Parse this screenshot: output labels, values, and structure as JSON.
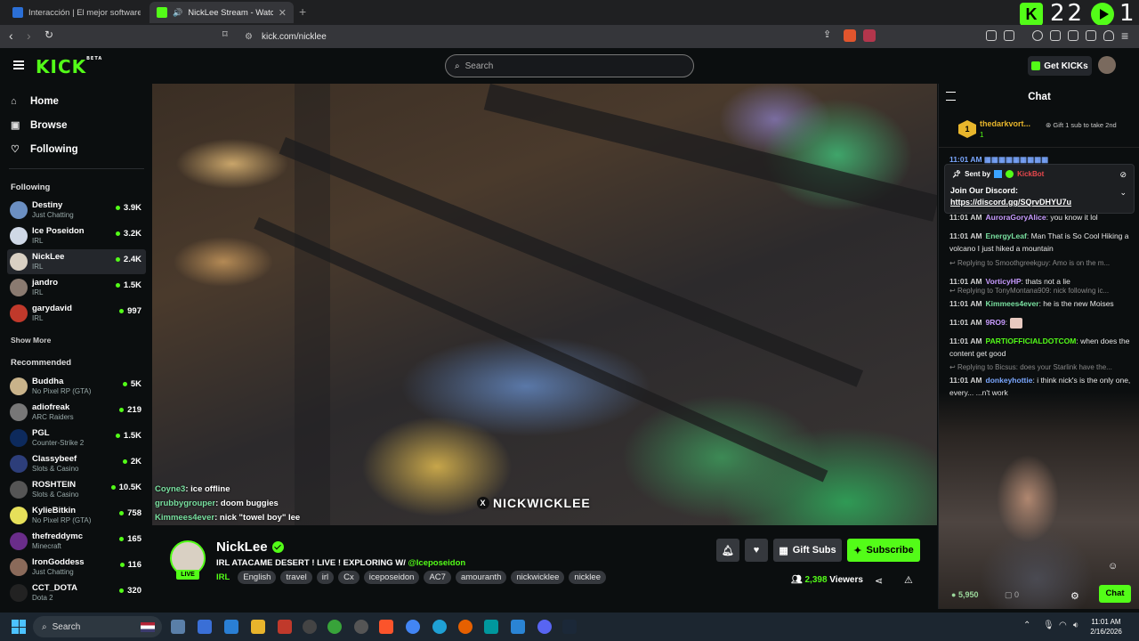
{
  "browser": {
    "tabs": [
      {
        "title": "Interacción | El mejor software para p",
        "active": false
      },
      {
        "title": "NickLee Stream - Watch Live",
        "active": true
      }
    ],
    "url": "kick.com/nicklee"
  },
  "overlay": {
    "count_left": "22",
    "count_right": "1"
  },
  "header": {
    "search_placeholder": "Search",
    "get_kicks_label": "Get KICKs",
    "logo_text": "KICK",
    "logo_beta": "BETA"
  },
  "sidebar": {
    "nav": [
      {
        "label": "Home",
        "icon": "home-icon"
      },
      {
        "label": "Browse",
        "icon": "browse-icon"
      },
      {
        "label": "Following",
        "icon": "heart-icon"
      }
    ],
    "following_title": "Following",
    "following": [
      {
        "name": "Destiny",
        "category": "Just Chatting",
        "viewers": "3.9K",
        "color": "#6b8fc2"
      },
      {
        "name": "Ice Poseidon",
        "category": "IRL",
        "viewers": "3.2K",
        "color": "#cfd8e6"
      },
      {
        "name": "NickLee",
        "category": "IRL",
        "viewers": "2.4K",
        "color": "#d9d0c3"
      },
      {
        "name": "jandro",
        "category": "IRL",
        "viewers": "1.5K",
        "color": "#8a7a70"
      },
      {
        "name": "garydavid",
        "category": "IRL",
        "viewers": "997",
        "color": "#c0392b"
      }
    ],
    "show_more": "Show More",
    "recommended_title": "Recommended",
    "recommended": [
      {
        "name": "Buddha",
        "category": "No Pixel RP (GTA)",
        "viewers": "5K",
        "color": "#c9b38a"
      },
      {
        "name": "adiofreak",
        "category": "ARC Raiders",
        "viewers": "219",
        "color": "#777"
      },
      {
        "name": "PGL",
        "category": "Counter-Strike 2",
        "viewers": "1.5K",
        "color": "#0d2a5c"
      },
      {
        "name": "Classybeef",
        "category": "Slots & Casino",
        "viewers": "2K",
        "color": "#2d3e7a"
      },
      {
        "name": "ROSHTEIN",
        "category": "Slots & Casino",
        "viewers": "10.5K",
        "color": "#555"
      },
      {
        "name": "KylieBitkin",
        "category": "No Pixel RP (GTA)",
        "viewers": "758",
        "color": "#e6e05a"
      },
      {
        "name": "thefreddymc",
        "category": "Minecraft",
        "viewers": "165",
        "color": "#6a2d8a"
      },
      {
        "name": "IronGoddess",
        "category": "Just Chatting",
        "viewers": "116",
        "color": "#8a6a5a"
      },
      {
        "name": "CCT_DOTA",
        "category": "Dota 2",
        "viewers": "320",
        "color": "#222"
      }
    ]
  },
  "video": {
    "chat_overlay": [
      {
        "user": "Coyne3",
        "text": "ice offline"
      },
      {
        "user": "grubbygrouper",
        "text": "doom buggies"
      },
      {
        "user": "Kimmees4ever",
        "text": "nick \"towel boy\" lee"
      }
    ],
    "watermark": "NICKWICKLEE"
  },
  "stream": {
    "name": "NickLee",
    "live_label": "LIVE",
    "title": "IRL ATACAME DESERT ! LIVE ! EXPLORING W/",
    "mention": "@Iceposeidon",
    "category": "IRL",
    "tags": [
      "English",
      "travel",
      "irl",
      "Cx",
      "iceposeidon",
      "AC7",
      "amouranth",
      "nickwicklee",
      "nicklee"
    ],
    "gift_subs_label": "Gift Subs",
    "subscribe_label": "Subscribe",
    "viewers": "2,398",
    "viewers_label": "Viewers"
  },
  "chat": {
    "title": "Chat",
    "leader_name": "thedarkvort...",
    "leader_count": "1",
    "leader_rank": "1",
    "gift_note": "Gift 1 sub to take 2nd",
    "pinned": {
      "sent_by": "Sent by",
      "bot": "KickBot",
      "text": "Join Our Discord:",
      "link": "https://discord.gg/SQrvDHYU7u"
    },
    "messages": [
      {
        "time": "11:01 AM",
        "user": "AuroraGoryAlice",
        "color": "#c89bff",
        "text": "you know it lol"
      },
      {
        "time": "11:01 AM",
        "user": "EnergyLeaf",
        "color": "#79e0a0",
        "text": "Man That is So Cool Hiking a volcano I just hiked a mountain"
      },
      {
        "time": "11:01 AM",
        "user": "VorticyHP",
        "color": "#c89bff",
        "text": "thats not a lie",
        "reply": "Replying to Smoothgreekguy: Amo is on the m..."
      },
      {
        "time": "11:01 AM",
        "user": "Kimmees4ever",
        "color": "#79e0a0",
        "text": "he is the new Moises",
        "reply": "Replying to TonyMontana909: nick following ic..."
      },
      {
        "time": "11:01 AM",
        "user": "9RO9",
        "color": "#c89bff",
        "text": ""
      },
      {
        "time": "11:01 AM",
        "user": "PARTIOFFICIALDOTCOM",
        "color": "#53fc18",
        "text": "when does the content get good"
      },
      {
        "time": "11:01 AM",
        "user": "donkeyhottie",
        "color": "#7aa7ff",
        "text": "i think nick's is the only one, every...  ...n't work",
        "reply": "Replying to Bicsus: does your Starlink have the..."
      }
    ],
    "footer_kicks": "5,950",
    "footer_zero": "0",
    "chat_button": "Chat"
  },
  "taskbar": {
    "search_label": "Search",
    "time": "11:01 AM",
    "date": "2/16/2026"
  }
}
